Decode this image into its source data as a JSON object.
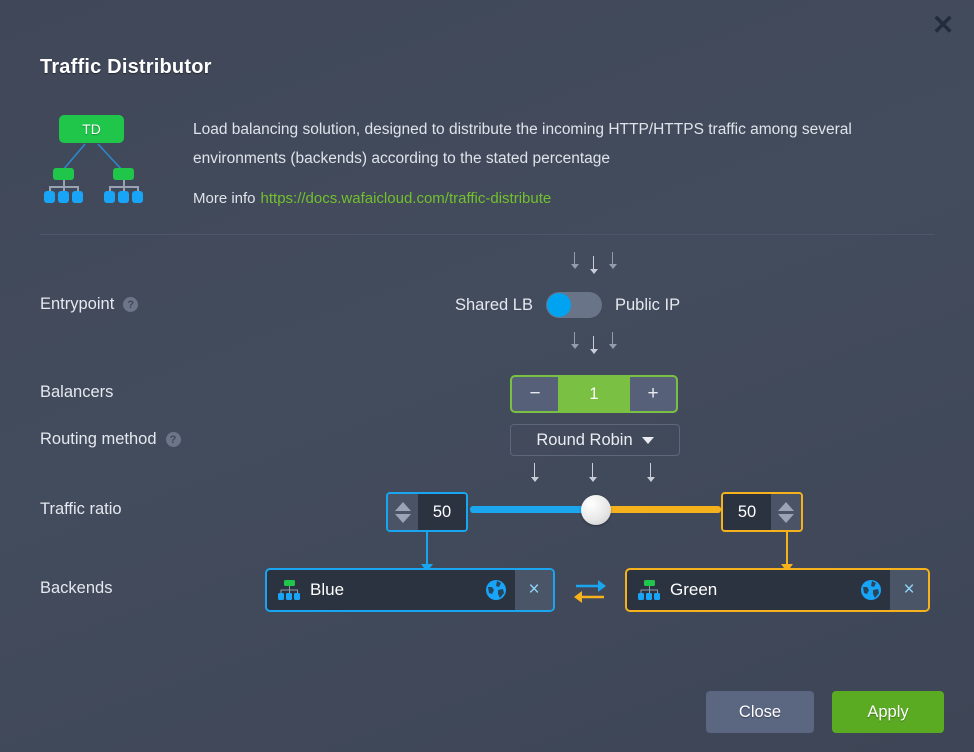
{
  "dialog": {
    "title": "Traffic Distributor",
    "close_icon": "close-icon",
    "badge_label": "TD",
    "description": "Load balancing solution, designed to distribute the incoming HTTP/HTTPS traffic among several environments (backends) according to the stated percentage",
    "more_info_label": "More info",
    "more_info_url": "https://docs.wafaicloud.com/traffic-distribute"
  },
  "entrypoint": {
    "label": "Entrypoint",
    "help_icon": "?",
    "option_left": "Shared LB",
    "option_right": "Public IP",
    "selected": "Shared LB",
    "knob_color": "#00a3f0"
  },
  "balancers": {
    "label": "Balancers",
    "decrement": "−",
    "value": "1",
    "increment": "+",
    "accent_color": "#7ac143"
  },
  "routing": {
    "label": "Routing method",
    "help_icon": "?",
    "value": "Round Robin"
  },
  "traffic_ratio": {
    "label": "Traffic ratio",
    "left_value": "50",
    "right_value": "50",
    "left_color": "#19a5f0",
    "right_color": "#f5b21c"
  },
  "backends": {
    "label": "Backends",
    "swap_icon": "swap-arrows-icon",
    "items": [
      {
        "name": "Blue",
        "globe_icon": "globe-icon",
        "remove_icon": "×",
        "color": "#19a5f0"
      },
      {
        "name": "Green",
        "globe_icon": "globe-icon",
        "remove_icon": "×",
        "color": "#f5b21c"
      }
    ]
  },
  "footer": {
    "close_label": "Close",
    "apply_label": "Apply"
  }
}
